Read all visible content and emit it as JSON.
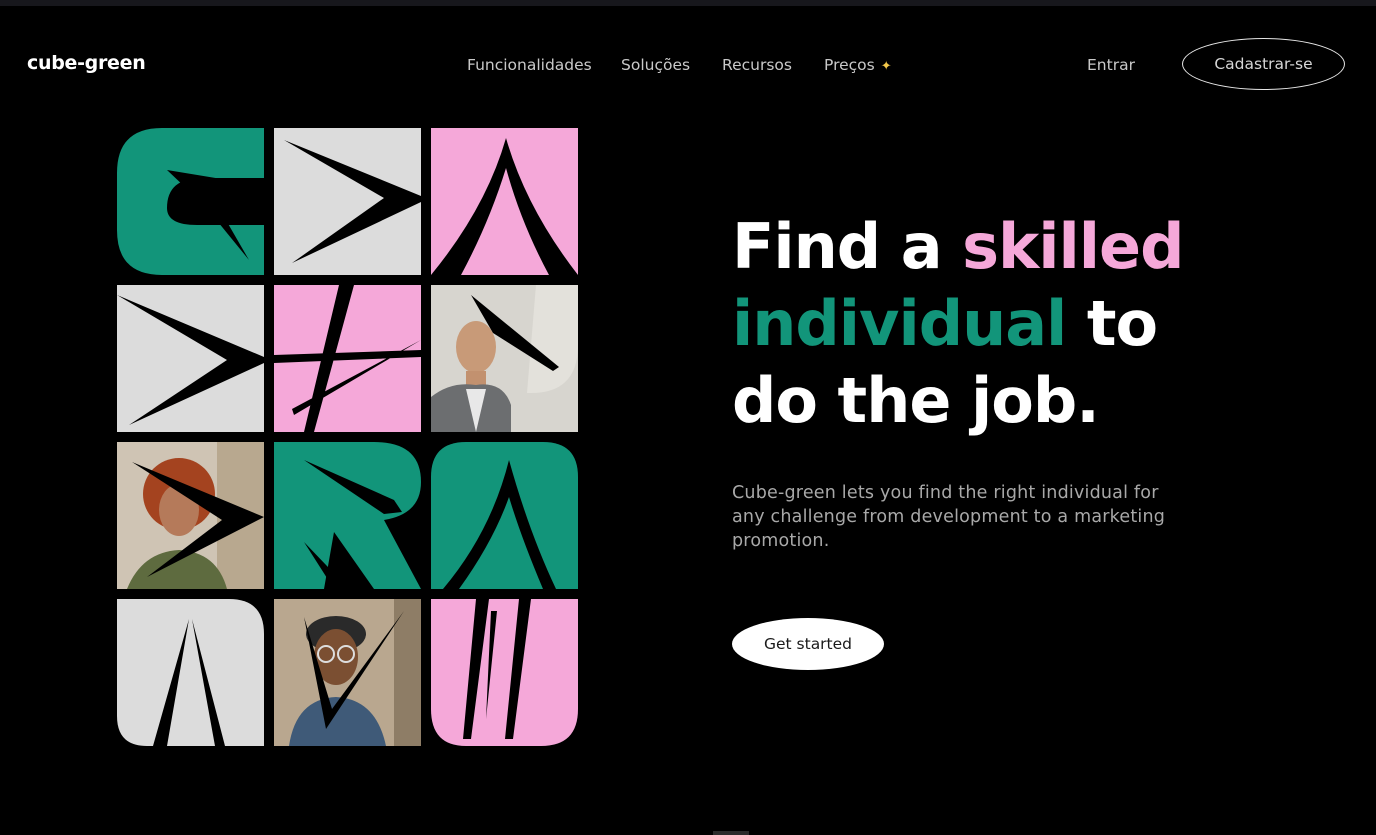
{
  "header": {
    "logo": "cube-green",
    "nav": [
      {
        "label": "Funcionalidades"
      },
      {
        "label": "Soluções"
      },
      {
        "label": "Recursos"
      },
      {
        "label": "Preços"
      }
    ],
    "pricing_sparkle_icon": "sparkles-icon",
    "login_label": "Entrar",
    "signup_label": "Cadastrar-se"
  },
  "hero": {
    "headline": {
      "part1": "Find a ",
      "highlight1": "skilled",
      "highlight2": "individual",
      "part2": " to",
      "part3": "do the job."
    },
    "description": "Cube-green lets you find the right individual for any challenge from development to a marketing promotion.",
    "cta_label": "Get started"
  },
  "colors": {
    "background": "#000000",
    "green": "#12957a",
    "pink": "#f5a8d9",
    "light_gray": "#dcdcdc",
    "text_muted": "#a8a8a8"
  },
  "mosaic": {
    "tiles": [
      {
        "kind": "shape",
        "color": "green",
        "glyph": "G"
      },
      {
        "kind": "shape",
        "color": "light_gray",
        "glyph": "arrow-right"
      },
      {
        "kind": "shape",
        "color": "pink",
        "glyph": "A"
      },
      {
        "kind": "shape",
        "color": "light_gray",
        "glyph": "arrow-right"
      },
      {
        "kind": "shape",
        "color": "pink",
        "glyph": "pinwheel"
      },
      {
        "kind": "photo",
        "subject": "man in gray blazer"
      },
      {
        "kind": "photo",
        "subject": "woman with curly red hair"
      },
      {
        "kind": "shape",
        "color": "green",
        "glyph": "R"
      },
      {
        "kind": "shape",
        "color": "green",
        "glyph": "A"
      },
      {
        "kind": "shape",
        "color": "light_gray",
        "glyph": "N"
      },
      {
        "kind": "photo",
        "subject": "man with beanie and glasses"
      },
      {
        "kind": "shape",
        "color": "pink",
        "glyph": "W"
      }
    ]
  }
}
